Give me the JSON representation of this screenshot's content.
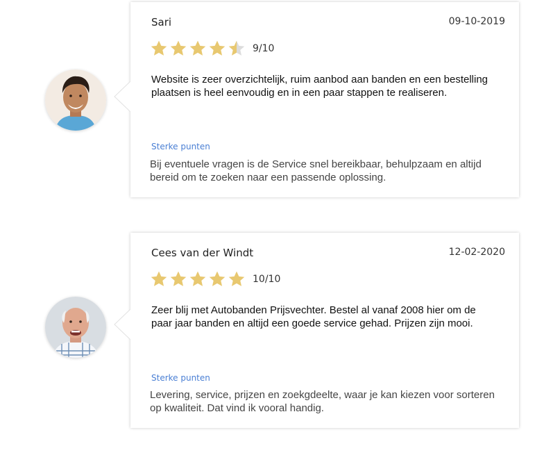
{
  "reviews": [
    {
      "name": "Sari",
      "date": "09-10-2019",
      "rating_stars": 4.5,
      "rating_max_stars": 5,
      "score": "9/10",
      "text": "Website is zeer overzichtelijk, ruim aanbod aan banden en een bestelling plaatsen is heel eenvoudig en in een paar stappen te realiseren.",
      "strong_label": "Sterke punten",
      "strong_text": "Bij eventuele vragen is de Service snel bereikbaar, behulpzaam en altijd bereid om te zoeken naar een passende oplossing.",
      "avatar_icon": "young-man-avatar"
    },
    {
      "name": "Cees van der Windt",
      "date": "12-02-2020",
      "rating_stars": 5,
      "rating_max_stars": 5,
      "score": "10/10",
      "text": "Zeer blij met Autobanden Prijsvechter. Bestel al vanaf 2008 hier om de paar jaar banden en altijd een goede service gehad. Prijzen zijn mooi.",
      "strong_label": "Sterke punten",
      "strong_text": "Levering, service, prijzen en zoekgdeelte, waar je kan kiezen voor sorteren op kwaliteit. Dat vind ik vooral handig.",
      "avatar_icon": "older-man-avatar"
    }
  ],
  "colors": {
    "star_filled": "#e8c870",
    "star_empty": "#dcdcdc",
    "label_blue": "#4a7fd4"
  }
}
